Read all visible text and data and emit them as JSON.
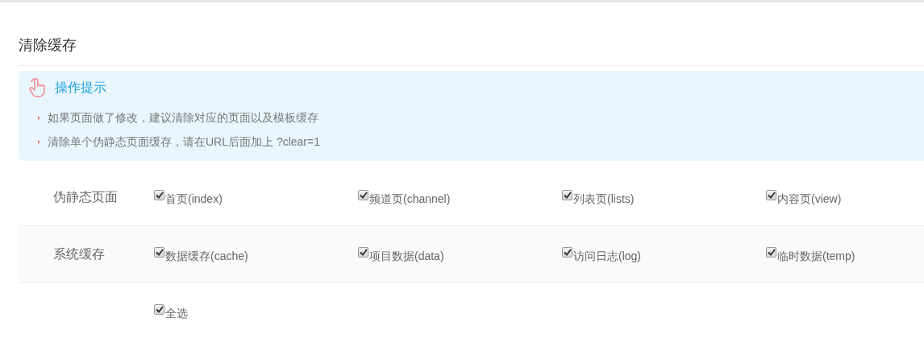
{
  "title": "清除缓存",
  "tips": {
    "title": "操作提示",
    "items": [
      "如果页面做了修改，建议清除对应的页面以及模板缓存",
      "清除单个伪静态页面缓存，请在URL后面加上 ?clear=1"
    ]
  },
  "rows": [
    {
      "label": "伪静态页面",
      "options": [
        {
          "label": "首页(index)",
          "checked": true
        },
        {
          "label": "频道页(channel)",
          "checked": true
        },
        {
          "label": "列表页(lists)",
          "checked": true
        },
        {
          "label": "内容页(view)",
          "checked": true
        }
      ]
    },
    {
      "label": "系统缓存",
      "options": [
        {
          "label": "数据缓存(cache)",
          "checked": true
        },
        {
          "label": "项目数据(data)",
          "checked": true
        },
        {
          "label": "访问日志(log)",
          "checked": true
        },
        {
          "label": "临时数据(temp)",
          "checked": true
        }
      ]
    },
    {
      "options": [
        {
          "label": "全选",
          "checked": true
        }
      ]
    }
  ]
}
